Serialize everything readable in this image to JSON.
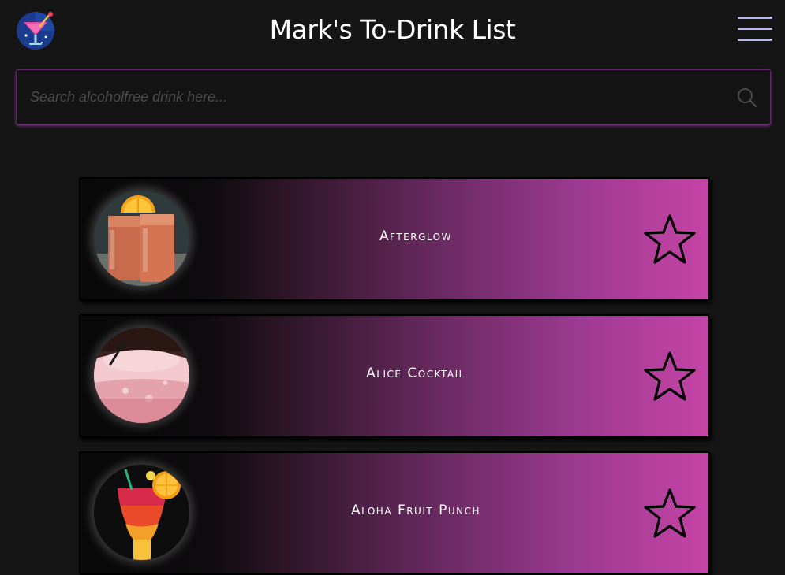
{
  "header": {
    "title": "Mark's To-Drink List",
    "logo_icon": "cocktail-glass-icon",
    "menu_icon": "hamburger-menu-icon"
  },
  "search": {
    "placeholder": "Search alcoholfree drink here...",
    "value": "",
    "icon": "search-icon"
  },
  "colors": {
    "background": "#151515",
    "accent_pink": "#c544a6",
    "search_glow": "#aa3cbe",
    "menu_lines": "#b8b8f0"
  },
  "drinks": [
    {
      "name": "Afterglow",
      "favorited": false,
      "image_icon": "afterglow-drink-photo"
    },
    {
      "name": "Alice Cocktail",
      "favorited": false,
      "image_icon": "alice-cocktail-photo"
    },
    {
      "name": "Aloha Fruit Punch",
      "favorited": false,
      "image_icon": "aloha-fruit-punch-photo"
    }
  ]
}
